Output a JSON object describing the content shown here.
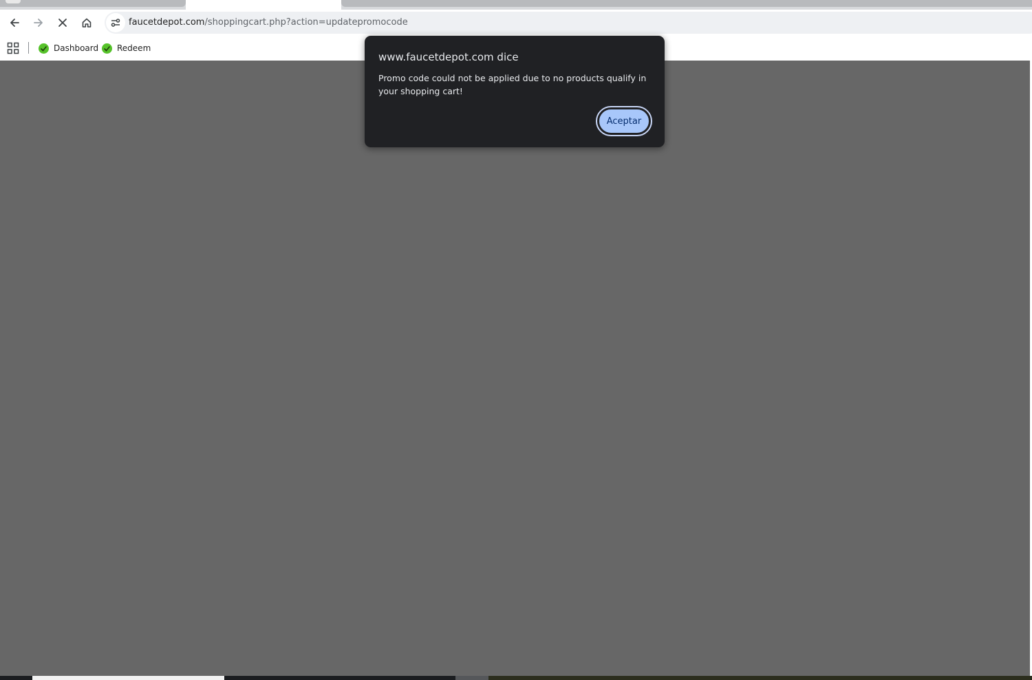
{
  "browser": {
    "url_domain": "faucetdepot.com",
    "url_path": "/shoppingcart.php?action=updatepromocode"
  },
  "bookmarks": [
    {
      "label": "Dashboard",
      "icon": "dashboard-favicon"
    },
    {
      "label": "Redeem",
      "icon": "redeem-favicon"
    }
  ],
  "dialog": {
    "title": "www.faucetdepot.com dice",
    "message": "Promo code could not be applied due to no products qualify in your shopping cart!",
    "ok_label": "Aceptar"
  },
  "colors": {
    "overlay": "#676767",
    "dialog_bg": "#202124",
    "button_bg": "#a8c7fa",
    "bookmark_icon": "#56c22a"
  }
}
